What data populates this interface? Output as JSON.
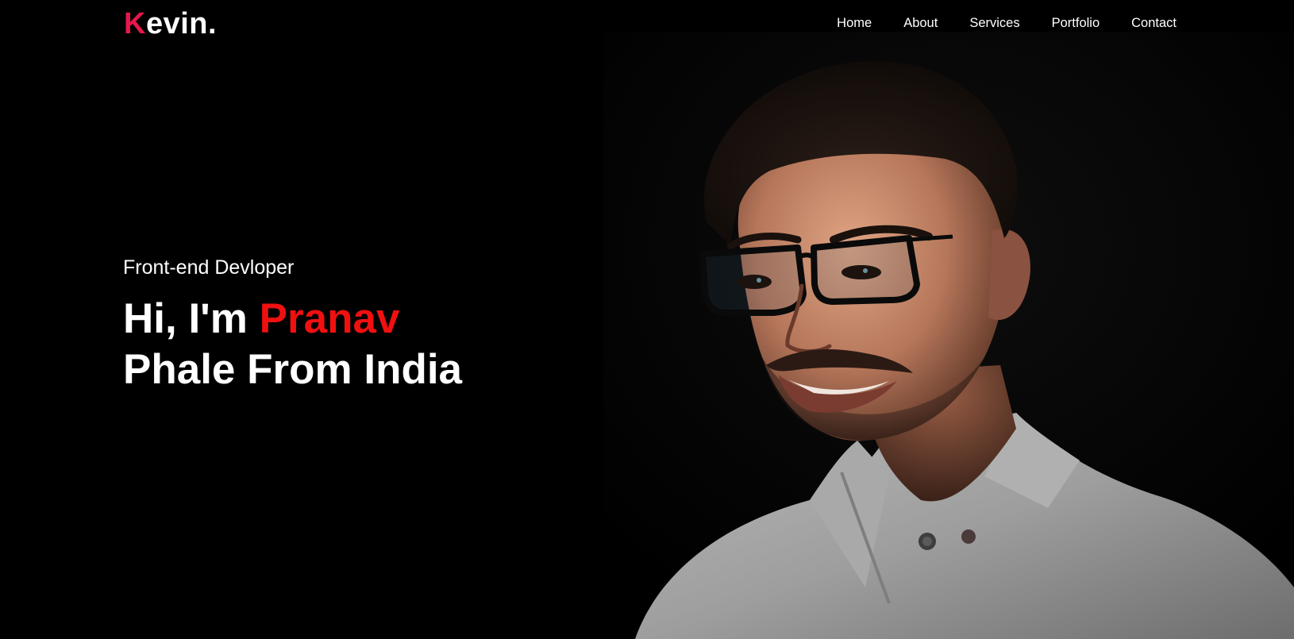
{
  "colors": {
    "brand": "#e8174a",
    "accent": "#f01010",
    "background": "#000000",
    "text": "#ffffff"
  },
  "logo": {
    "first_letter": "K",
    "rest": "evin."
  },
  "nav": {
    "items": [
      {
        "label": "Home"
      },
      {
        "label": "About"
      },
      {
        "label": "Services"
      },
      {
        "label": "Portfolio"
      },
      {
        "label": "Contact"
      }
    ]
  },
  "hero": {
    "subtitle": "Front-end Devloper",
    "greeting": "Hi, I'm ",
    "name_highlight": "Pranav",
    "line2": "Phale From India",
    "portrait_icon": "portrait-photo"
  }
}
